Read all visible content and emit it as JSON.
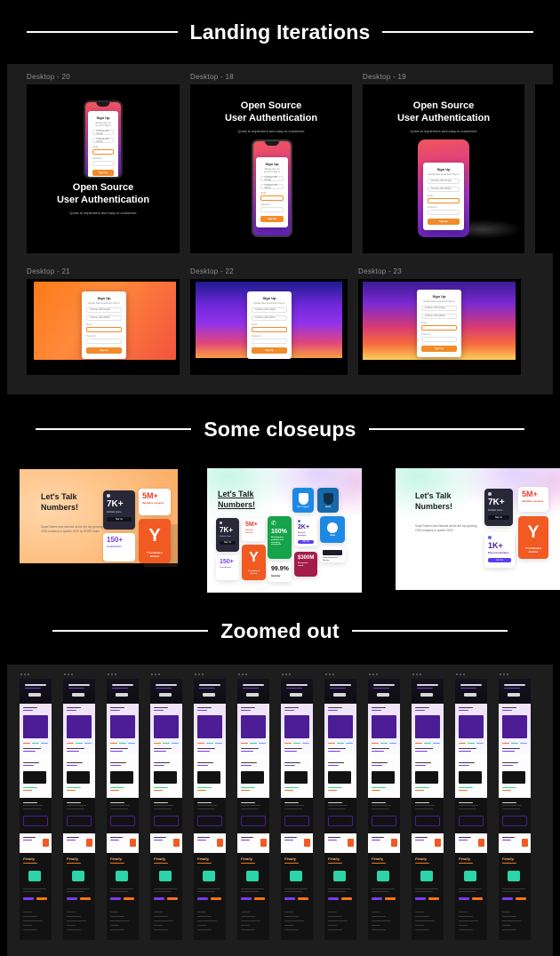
{
  "sections": [
    {
      "id": "landing",
      "title": "Landing Iterations"
    },
    {
      "id": "closeups",
      "title": "Some closeups"
    },
    {
      "id": "zoomed",
      "title": "Zoomed out"
    }
  ],
  "landing": {
    "frames": [
      {
        "label": "Desktop - 20",
        "variant": "hero-below",
        "heading": "Open Source\nUser Authentication",
        "sub": "Quick to implement and easy to customize"
      },
      {
        "label": "Desktop - 18",
        "variant": "hero-above",
        "heading": "Open Source\nUser Authentication",
        "sub": "Quick to implement and easy to customize"
      },
      {
        "label": "Desktop - 19",
        "variant": "hero-above-shadow",
        "heading": "Open Source\nUser Authentication",
        "sub": "Quick to implement and easy to customize"
      },
      {
        "label": "Desktop - 21",
        "variant": "gradient-orange"
      },
      {
        "label": "Desktop - 22",
        "variant": "gradient-purple"
      },
      {
        "label": "Desktop - 23",
        "variant": "gradient-sunset"
      }
    ],
    "signup": {
      "title": "Sign Up",
      "subtitle": "Already have an account? Sign In",
      "oauth_google": "Continue with Google",
      "oauth_github": "Continue with GitHub",
      "email_label": "Email",
      "password_label": "Password",
      "button": "Sign Up"
    }
  },
  "closeups": {
    "cards": [
      {
        "background": "orange",
        "heading": "Let's Talk\nNumbers!",
        "underline": false,
        "body": "SuperTokens was indexed as the 4th top growing OSS company in quarter 2022 by ROSS Index.",
        "stats": [
          {
            "value": "7K+",
            "label": "Github stars",
            "cta": "Star Us",
            "style": "dark"
          },
          {
            "value": "5M+",
            "label": "Identities secured",
            "style": "white-red"
          },
          {
            "value": "150+",
            "label": "Contributors",
            "style": "white-purple"
          },
          {
            "value": "Y",
            "label": "Y Combinator Backed",
            "style": "orange"
          }
        ]
      },
      {
        "background": "light",
        "heading": "Let's Talk\nNumbers!",
        "underline": true,
        "stats": [
          {
            "value": "7K+",
            "label": "Github stars",
            "cta": "Star Us",
            "style": "dark"
          },
          {
            "value": "5M+",
            "label": "Identities secured",
            "style": "white-red"
          },
          {
            "value": "100%",
            "label": "Bootstrapped, profitable and trusted by enterprises",
            "style": "green"
          },
          {
            "value": "2K+",
            "label": "Discord members",
            "cta": "Join Us",
            "style": "white-purple"
          },
          {
            "value": "150+",
            "label": "Contributors",
            "style": "white-purple"
          },
          {
            "value": "Y",
            "label": "Y Combinator Backed",
            "style": "orange"
          },
          {
            "value": "99.9%",
            "label": "Uptime",
            "style": "white-dark"
          },
          {
            "value": "$300M",
            "label": "Ecosystem saved",
            "style": "maroon"
          }
        ],
        "badges": [
          {
            "label": "SOC 2 Type II",
            "sub": "gold check",
            "style": "blue"
          },
          {
            "label": "GDPR",
            "sub": "spec check",
            "style": "blue-dark"
          },
          {
            "label": "HIPAA",
            "sub": "fully included",
            "style": "blue"
          },
          {
            "label": "Today Showing #3 Startup",
            "style": "dark-chip"
          }
        ]
      },
      {
        "background": "light",
        "heading": "Let's Talk\nNumbers!",
        "underline": false,
        "body": "SuperTokens was indexed as the 4th top growing OSS company in quarter 2022.",
        "stats": [
          {
            "value": "7K+",
            "label": "Github stars",
            "cta": "Star Us",
            "style": "dark"
          },
          {
            "value": "5M+",
            "label": "Identities secured",
            "style": "white-red"
          },
          {
            "value": "1K+",
            "label": "Discord members",
            "cta": "Join Us",
            "style": "white-purple"
          },
          {
            "value": "Y",
            "label": "Y Combinator Backed",
            "style": "orange"
          }
        ]
      }
    ]
  },
  "zoomed": {
    "columns": 12,
    "dots_per_column": 3,
    "finally_label": "Finally,"
  },
  "colors": {
    "background": "#000000",
    "panel": "#1d1d1d",
    "frame_label": "#8f8f8f",
    "heading": "#ffffff",
    "accent_orange": "#f15a22",
    "accent_purple": "#7c3aed",
    "accent_green": "#16a34a",
    "accent_blue": "#1e88e5",
    "accent_maroon": "#a31c4a"
  }
}
